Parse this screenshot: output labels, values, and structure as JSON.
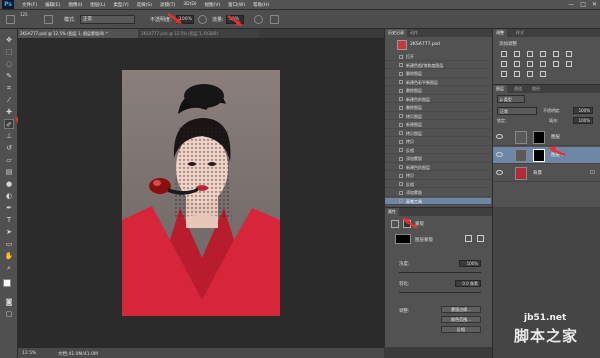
{
  "app": {
    "logo": "Ps"
  },
  "menu": [
    "文件(F)",
    "编辑(E)",
    "图像(I)",
    "图层(L)",
    "类型(Y)",
    "选择(S)",
    "滤镜(T)",
    "3D(D)",
    "视图(V)",
    "窗口(W)",
    "帮助(H)"
  ],
  "window_controls": [
    "—",
    "□",
    "✕"
  ],
  "options": {
    "brush_size": "125",
    "mode_label": "模式:",
    "mode_value": "正常",
    "opacity_label": "不透明度:",
    "opacity_value": "100%",
    "flow_label": "流量:",
    "flow_value": "30%"
  },
  "tabs": [
    {
      "label": "2KSA777.psd @ 12.5% (图层 1, 图层蒙版/8) *",
      "close": "×"
    },
    {
      "label": "2KSA777.psd @ 12.5% (图层 1, RGB/8)",
      "close": "×"
    }
  ],
  "tools": [
    "move-tool",
    "marquee-tool",
    "lasso-tool",
    "quick-select-tool",
    "crop-tool",
    "eyedropper-tool",
    "healing-tool",
    "brush-tool",
    "clone-tool",
    "history-brush-tool",
    "eraser-tool",
    "gradient-tool",
    "blur-tool",
    "dodge-tool",
    "pen-tool",
    "type-tool",
    "path-select-tool",
    "shape-tool",
    "hand-tool",
    "zoom-tool"
  ],
  "status": {
    "zoom": "12.5%",
    "doc": "文档:41.0M/41.0M"
  },
  "history": {
    "tabs": [
      "历史记录",
      "动作"
    ],
    "snapshot": "2KSA777.psd",
    "items": [
      "打开",
      "新建色相/饱和度图层",
      "删除图层",
      "新建色彩平衡图层",
      "删除图层",
      "新建色阶图层",
      "删除图层",
      "拷贝图层",
      "新建图层",
      "拷贝图层",
      "拷贝",
      "反相",
      "添加蒙版",
      "新建色阶图层",
      "拷贝",
      "反相",
      "添加蒙版",
      "画笔工具"
    ],
    "selected_index": 17
  },
  "adjustments": {
    "tabs": [
      "调整",
      "样式"
    ],
    "title": "添加调整"
  },
  "layers": {
    "tabs": [
      "图层",
      "通道",
      "路径"
    ],
    "kind": "p 类型",
    "blend": "正常",
    "opacity_label": "不透明度:",
    "opacity": "100%",
    "lock_label": "锁定:",
    "fill_label": "填充:",
    "fill": "100%",
    "items": [
      {
        "name": "图层",
        "type": "mask"
      },
      {
        "name": "图层 1",
        "type": "mask",
        "selected": true
      },
      {
        "name": "背景",
        "type": "photo",
        "locked": true
      }
    ]
  },
  "properties": {
    "title": "属性",
    "section": "蒙版",
    "layer_mask": "图层蒙版",
    "density_label": "浓度:",
    "density": "100%",
    "feather_label": "羽化:",
    "feather": "0.0 像素",
    "refine_label": "调整:",
    "buttons": [
      "蒙版边缘...",
      "颜色范围...",
      "反相"
    ]
  },
  "watermark": {
    "url": "jb51.net",
    "text": "脚本之家"
  },
  "colors": {
    "accent": "#e8302c",
    "selection": "#6e87a6",
    "panel": "#525252",
    "canvas": "#2b2b2b"
  }
}
